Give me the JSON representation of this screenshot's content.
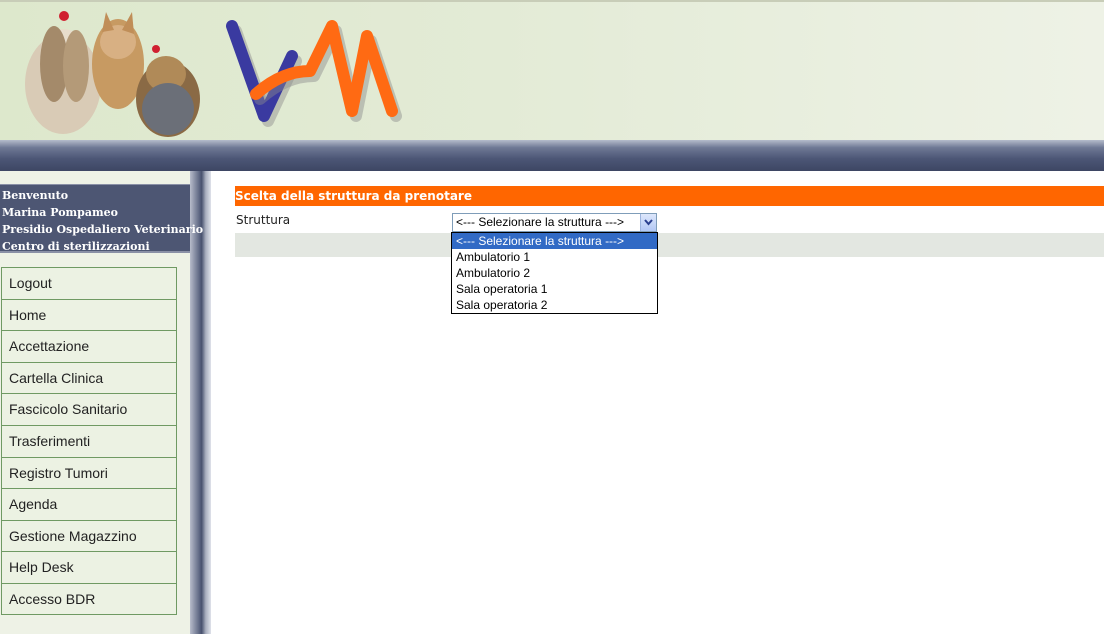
{
  "user": {
    "lines": [
      "Benvenuto",
      "Marina Pompameo",
      "Presidio Ospedaliero Veterinario",
      "Centro di sterilizzazioni"
    ]
  },
  "menu": {
    "items": [
      "Logout",
      "Home",
      "Accettazione",
      "Cartella Clinica",
      "Fascicolo Sanitario",
      "Trasferimenti",
      "Registro Tumori",
      "Agenda",
      "Gestione Magazzino",
      "Help Desk",
      "Accesso BDR"
    ]
  },
  "main": {
    "title": "Scelta della struttura da prenotare",
    "field_label": "Struttura",
    "select": {
      "value": "<--- Selezionare la struttura --->",
      "options": [
        "<--- Selezionare la struttura --->",
        "Ambulatorio 1",
        "Ambulatorio 2",
        "Sala operatoria 1",
        "Sala operatoria 2"
      ],
      "selected_index": 0
    }
  },
  "colors": {
    "accent_orange": "#ff6600",
    "nav_dark": "#4d5673",
    "logo_blue": "#3a3aa0",
    "logo_orange": "#ff6a13"
  },
  "icons": {
    "header_image": "dogs-illustration",
    "logo": "vam-logo",
    "dropdown": "chevron-down-icon"
  }
}
